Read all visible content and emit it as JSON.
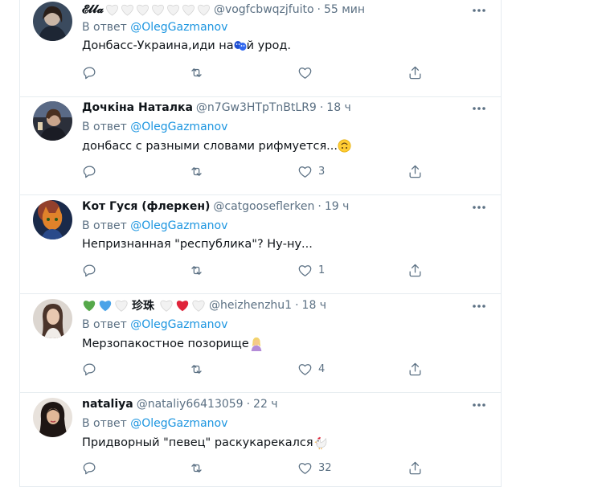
{
  "reply_prefix": "В ответ",
  "tweets": [
    {
      "name": "𝓔𝓵𝓵𝓪",
      "name_badges": [
        "white-heart-icon",
        "white-heart-icon",
        "white-heart-icon",
        "white-heart-icon",
        "white-heart-icon",
        "white-heart-icon",
        "white-heart-icon"
      ],
      "handle": "@vogfcbwqzjfuito",
      "time": "55 мин",
      "reply_to": "@OlegGazmanov",
      "text_before": "Донбасс-Украина,иди на",
      "text_emoji": "blue-masks-icon",
      "text_after": "й урод.",
      "likes": ""
    },
    {
      "name": "Дочкіна Наталка",
      "handle": "@n7Gw3HTpTnBtLR9",
      "time": "18 ч",
      "reply_to": "@OlegGazmanov",
      "text_before": "донбасс с разными словами рифмуется...",
      "text_emoji": "upside-down-face-icon",
      "text_after": "",
      "likes": "3"
    },
    {
      "name": "Кот Гуся (флеркен)",
      "handle": "@catgooseflerken",
      "time": "19 ч",
      "reply_to": "@OlegGazmanov",
      "text_before": "Непризнанная \"республика\"? Ну-ну...",
      "text_emoji": "",
      "text_after": "",
      "likes": "1"
    },
    {
      "name_prefix_badges": [
        "green-heart-icon",
        "blue-heart-icon",
        "white-heart-icon"
      ],
      "name": "珍珠",
      "name_badges": [
        "white-heart-icon",
        "red-heart-icon",
        "white-heart-icon"
      ],
      "handle": "@heizhenzhu1",
      "time": "18 ч",
      "reply_to": "@OlegGazmanov",
      "text_before": "Мерзопакостное позорище",
      "text_emoji": "facepalm-woman-icon",
      "text_after": "",
      "likes": "4"
    },
    {
      "name": "nataliya",
      "handle": "@nataliy66413059",
      "time": "22 ч",
      "reply_to": "@OlegGazmanov",
      "text_before": "Придворный \"певец\" раскукарекался",
      "text_emoji": "rooster-icon",
      "text_after": "",
      "likes": "32"
    }
  ],
  "colors": {
    "text": "#0f1419",
    "secondary": "#5b7083",
    "link": "#1b95e0",
    "border": "#e6ecf0"
  }
}
